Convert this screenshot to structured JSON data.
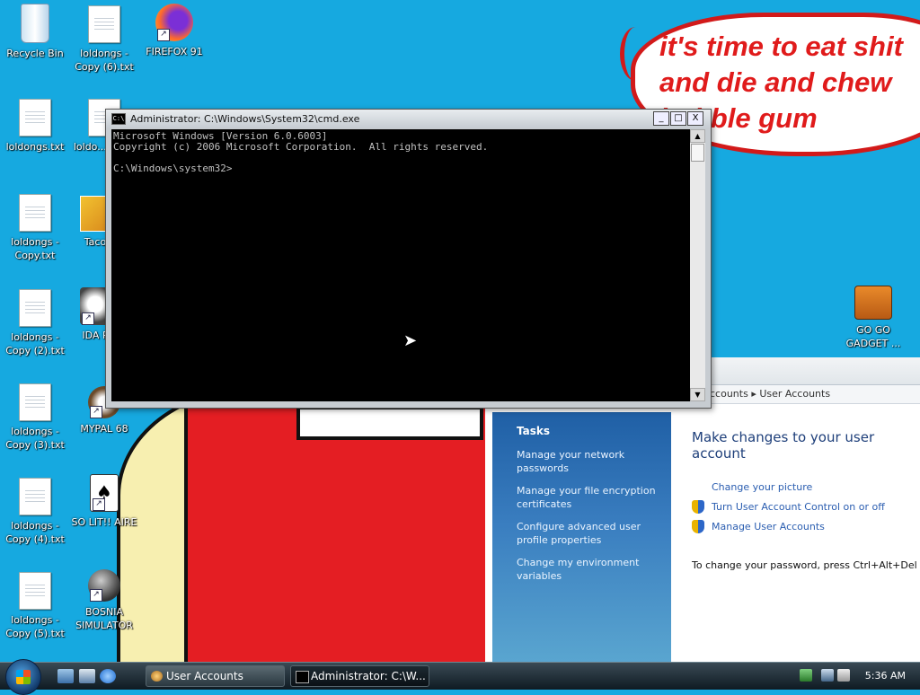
{
  "wallpaper": {
    "speech_text": "it's time to eat shit\nand die and chew\nbubble gum"
  },
  "desktop_icons": [
    {
      "label": "Recycle Bin",
      "kind": "recycle"
    },
    {
      "label": "loldongs - Copy (6).txt",
      "kind": "doc"
    },
    {
      "label": "FIREFOX 91",
      "kind": "firefox"
    },
    {
      "label": "loldongs.txt",
      "kind": "doc"
    },
    {
      "label": "loldo... Copy",
      "kind": "doc"
    },
    {
      "label": "loldongs - Copy.txt",
      "kind": "doc"
    },
    {
      "label": "Taco",
      "kind": "app"
    },
    {
      "label": "loldongs - Copy (2).txt",
      "kind": "doc"
    },
    {
      "label": "IDA P",
      "kind": "app"
    },
    {
      "label": "loldongs - Copy (3).txt",
      "kind": "doc"
    },
    {
      "label": "MYPAL 68",
      "kind": "app"
    },
    {
      "label": "loldongs - Copy (4).txt",
      "kind": "doc"
    },
    {
      "label": "SO LIT!! AIRE",
      "kind": "app"
    },
    {
      "label": "loldongs - Copy (5).txt",
      "kind": "doc"
    },
    {
      "label": "BOSNIA SIMULATOR",
      "kind": "app"
    },
    {
      "label": "GO GO GADGET ...",
      "kind": "briefcase"
    }
  ],
  "cmd": {
    "title": "Administrator: C:\\Windows\\System32\\cmd.exe",
    "icon_text": "C:\\",
    "output": "Microsoft Windows [Version 6.0.6003]\nCopyright (c) 2006 Microsoft Corporation.  All rights reserved.\n\nC:\\Windows\\system32>",
    "buttons": {
      "minimize": "_",
      "maximize": "□",
      "close": "X"
    }
  },
  "control_panel": {
    "breadcrumb": [
      "ccounts",
      "User Accounts"
    ],
    "tasks_title": "Tasks",
    "tasks": [
      "Manage your network passwords",
      "Manage your file encryption certificates",
      "Configure advanced user profile properties",
      "Change my environment variables"
    ],
    "heading": "Make changes to your user account",
    "links": [
      {
        "label": "Change your picture",
        "shield": false
      },
      {
        "label": "Turn User Account Control on or off",
        "shield": true
      },
      {
        "label": "Manage User Accounts",
        "shield": true
      }
    ],
    "note": "To change your password, press Ctrl+Alt+Del an"
  },
  "taskbar": {
    "buttons": [
      {
        "label": "User Accounts",
        "active": false
      },
      {
        "label": "Administrator: C:\\W...",
        "active": true
      }
    ],
    "clock": "5:36 AM"
  }
}
